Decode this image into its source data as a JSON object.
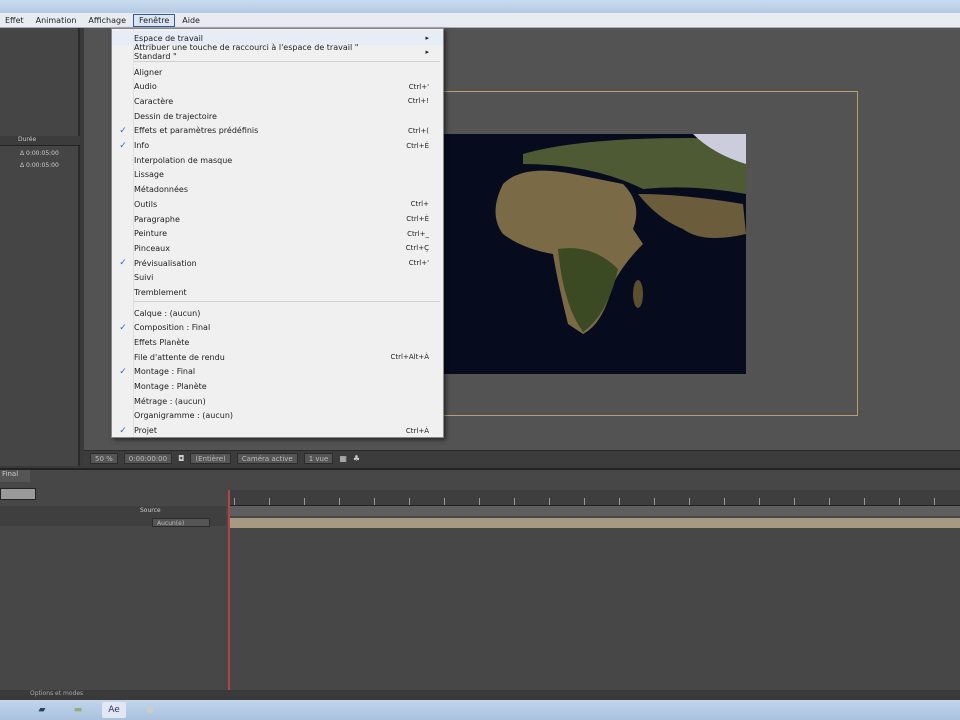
{
  "menubar": {
    "items": [
      "Effet",
      "Animation",
      "Affichage",
      "Fenêtre",
      "Aide"
    ],
    "active": "Fenêtre"
  },
  "menu": {
    "top": [
      {
        "label": "Espace de travail",
        "submenu": true
      },
      {
        "label": "Attribuer une touche de raccourci à l'espace de travail \" Standard \"",
        "submenu": true
      }
    ],
    "group1": [
      {
        "label": "Aligner",
        "shortcut": "",
        "checked": false
      },
      {
        "label": "Audio",
        "shortcut": "Ctrl+'",
        "checked": false
      },
      {
        "label": "Caractère",
        "shortcut": "Ctrl+!",
        "checked": false
      },
      {
        "label": "Dessin de trajectoire",
        "shortcut": "",
        "checked": false
      },
      {
        "label": "Effets et paramètres prédéfinis",
        "shortcut": "Ctrl+(",
        "checked": true
      },
      {
        "label": "Info",
        "shortcut": "Ctrl+É",
        "checked": true
      },
      {
        "label": "Interpolation de masque",
        "shortcut": "",
        "checked": false
      },
      {
        "label": "Lissage",
        "shortcut": "",
        "checked": false
      },
      {
        "label": "Métadonnées",
        "shortcut": "",
        "checked": false
      },
      {
        "label": "Outils",
        "shortcut": "Ctrl+",
        "checked": false
      },
      {
        "label": "Paragraphe",
        "shortcut": "Ctrl+È",
        "checked": false
      },
      {
        "label": "Peinture",
        "shortcut": "Ctrl+_",
        "checked": false
      },
      {
        "label": "Pinceaux",
        "shortcut": "Ctrl+Ç",
        "checked": false
      },
      {
        "label": "Prévisualisation",
        "shortcut": "Ctrl+'",
        "checked": true
      },
      {
        "label": "Suivi",
        "shortcut": "",
        "checked": false
      },
      {
        "label": "Tremblement",
        "shortcut": "",
        "checked": false
      }
    ],
    "group2": [
      {
        "label": "Calque : (aucun)",
        "shortcut": "",
        "checked": false
      },
      {
        "label": "Composition : Final",
        "shortcut": "",
        "checked": true
      },
      {
        "label": "Effets Planète",
        "shortcut": "",
        "checked": false
      },
      {
        "label": "File d'attente de rendu",
        "shortcut": "Ctrl+Alt+À",
        "checked": false
      },
      {
        "label": "Montage : Final",
        "shortcut": "",
        "checked": true
      },
      {
        "label": "Montage : Planète",
        "shortcut": "",
        "checked": false
      },
      {
        "label": "Métrage : (aucun)",
        "shortcut": "",
        "checked": false
      },
      {
        "label": "Organigramme : (aucun)",
        "shortcut": "",
        "checked": false
      },
      {
        "label": "Projet",
        "shortcut": "Ctrl+À",
        "checked": true
      }
    ]
  },
  "left_panel": {
    "col_header": "Durée",
    "durations": [
      "Δ 0:00:05:00",
      "Δ 0:00:05:00"
    ]
  },
  "viewer_bar": {
    "zoom": "50 %",
    "timecode": "0:00:00:00",
    "resolution": "(Entière)",
    "camera": "Caméra active",
    "views": "1 vue"
  },
  "timeline": {
    "tab": "Final",
    "source_col": "Source",
    "parent_value": "Aucun(e)"
  },
  "status": {
    "text": "Options et modes"
  },
  "colors": {
    "accent": "#2a6ac0",
    "playhead": "#b5434a",
    "layer_bar": "#a79a82"
  }
}
